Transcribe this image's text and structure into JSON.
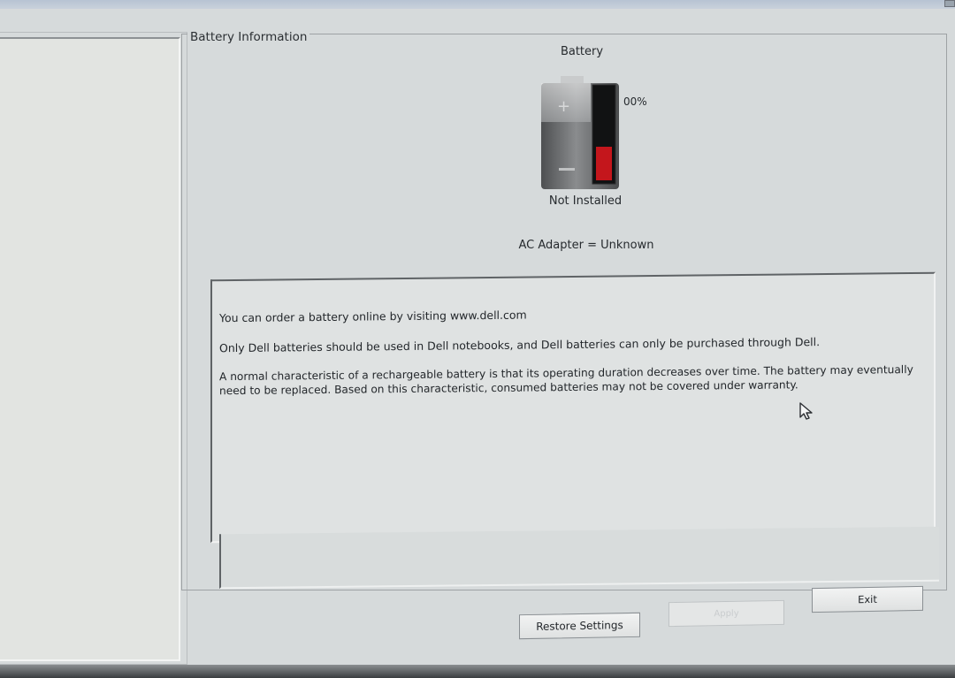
{
  "window": {
    "group_title": "Battery Information"
  },
  "battery": {
    "heading": "Battery",
    "percent_text": "00%",
    "charge_fraction": 0.0,
    "status": "Not Installed",
    "ac_adapter": "AC Adapter = Unknown"
  },
  "info": {
    "line1": "You can order a battery online by visiting www.dell.com",
    "line2": "Only Dell batteries should be used in Dell notebooks, and Dell batteries can only be purchased through Dell.",
    "paragraph": "A normal characteristic of a rechargeable battery is that its operating duration decreases over time.  The battery may eventually need to be replaced.  Based on this characteristic, consumed batteries may not be covered under warranty."
  },
  "buttons": {
    "restore": "Restore Settings",
    "apply": "Apply",
    "exit": "Exit"
  },
  "colors": {
    "gauge_fill": "#c4161c",
    "battery_body": "#6e7072"
  }
}
